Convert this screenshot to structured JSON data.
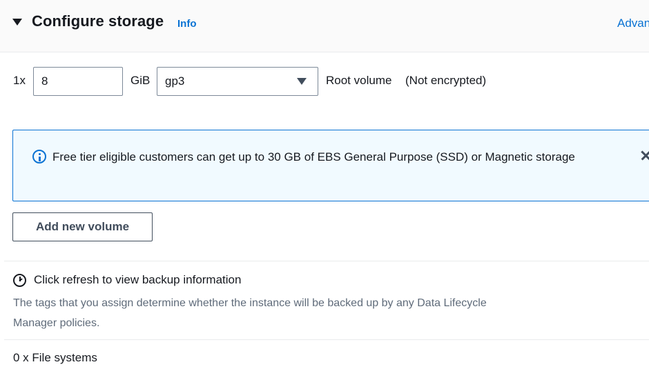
{
  "section": {
    "title": "Configure storage",
    "info_link": "Info",
    "advanced_link": "Advanced"
  },
  "volume": {
    "count_label": "1x",
    "size_value": "8",
    "size_unit": "GiB",
    "type_value": "gp3",
    "root_label": "Root volume",
    "encryption_label": "(Not encrypted)"
  },
  "alert": {
    "icon": "info-icon",
    "text": "Free tier eligible customers can get up to 30 GB of EBS General Purpose (SSD) or Magnetic storage"
  },
  "add_volume_button": "Add new volume",
  "backup": {
    "icon": "clock-icon",
    "title": "Click refresh to view backup information",
    "description": "The tags that you assign determine whether the instance will be backed up by any Data Lifecycle Manager policies."
  },
  "file_systems": {
    "label": "0 x File systems"
  },
  "colors": {
    "link": "#0972d3",
    "alert_bg": "#f1faff",
    "alert_border": "#0972d3",
    "text": "#16191f",
    "secondary_text": "#5f6b7a"
  }
}
